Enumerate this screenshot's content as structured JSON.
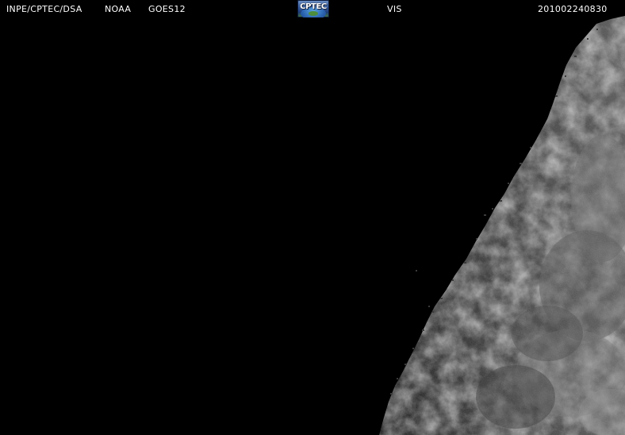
{
  "header": {
    "organization": "INPE/CPTEC/DSA",
    "agency": "NOAA",
    "satellite": "GOES12",
    "channel": "VIS",
    "timestamp": "201002240830"
  },
  "logo": {
    "text": "CPTEC",
    "icon": "cptec-globe-logo"
  },
  "colors": {
    "background": "#000000",
    "header_text": "#ffffff",
    "cloud_light": "#9a9a9a",
    "cloud_mid": "#5e5e5e",
    "cloud_dark": "#2e2e2e"
  }
}
